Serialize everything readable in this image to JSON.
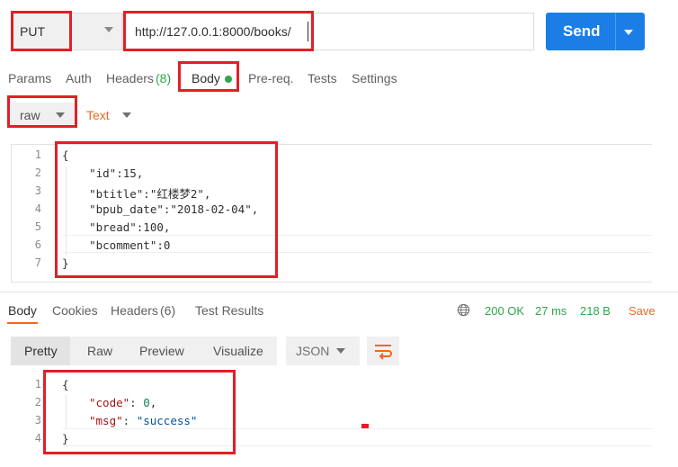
{
  "request": {
    "method": "PUT",
    "url": "http://127.0.0.1:8000/books/",
    "send_label": "Send"
  },
  "request_tabs": [
    "Params",
    "Auth",
    "Headers",
    "(8)",
    "Body",
    "Pre-req.",
    "Tests",
    "Settings"
  ],
  "body_options": {
    "mode": "raw",
    "format": "Text"
  },
  "request_body": {
    "line_numbers": [
      "1",
      "2",
      "3",
      "4",
      "5",
      "6",
      "7"
    ],
    "lines": [
      "{",
      "    \"id\":15,",
      "    \"btitle\":\"红楼梦2\",",
      "    \"bpub_date\":\"2018-02-04\",",
      "    \"bread\":100,",
      "    \"bcomment\":0",
      "}"
    ]
  },
  "response_tabs": [
    "Body",
    "Cookies",
    "Headers",
    "(6)",
    "Test Results"
  ],
  "response_status": {
    "status": "200 OK",
    "time": "27 ms",
    "size": "218 B",
    "save": "Save"
  },
  "response_toolbar": {
    "views": [
      "Pretty",
      "Raw",
      "Preview",
      "Visualize"
    ],
    "format": "JSON"
  },
  "response_body": {
    "line_numbers": [
      "1",
      "2",
      "3",
      "4"
    ],
    "open": "{",
    "code_key": "\"code\"",
    "code_value": "0",
    "msg_key": "\"msg\"",
    "msg_value": "\"success\"",
    "close": "}",
    "colon": ": ",
    "comma": ","
  },
  "colors": {
    "accent": "#f06722",
    "send": "#1a7ee6",
    "ok": "#2ea64a",
    "annotation": "#e41e26"
  },
  "icons": [
    "chevron-down-icon",
    "globe-icon",
    "wrap-lines-icon"
  ]
}
